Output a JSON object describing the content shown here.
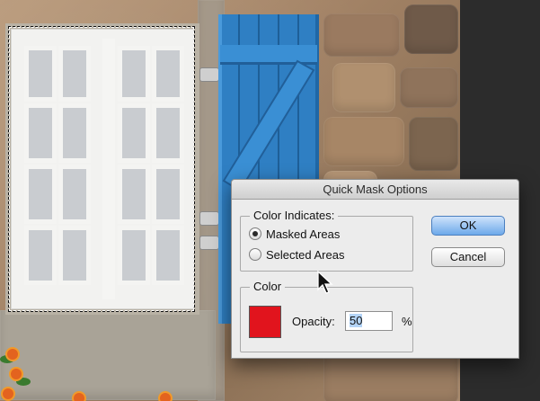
{
  "dialog": {
    "title": "Quick Mask Options",
    "color_indicates": {
      "legend": "Color Indicates:",
      "options": [
        {
          "label": "Masked Areas",
          "checked": true
        },
        {
          "label": "Selected Areas",
          "checked": false
        }
      ]
    },
    "color_group": {
      "legend": "Color",
      "swatch_color": "#e1141d",
      "opacity_label": "Opacity:",
      "opacity_value": "50",
      "percent_sign": "%"
    },
    "buttons": {
      "ok": "OK",
      "cancel": "Cancel"
    }
  },
  "colors": {
    "shutter_blue": "#2f7fc3",
    "ok_button_blue": "#6da9ea"
  }
}
